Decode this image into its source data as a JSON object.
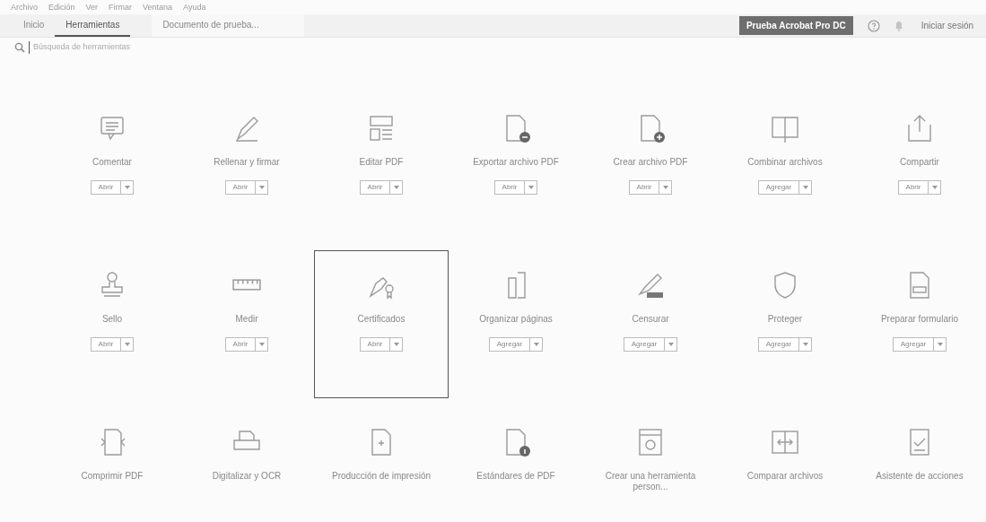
{
  "menu_bar": [
    "Archivo",
    "Edición",
    "Ver",
    "Firmar",
    "Ventana",
    "Ayuda"
  ],
  "tabs": [
    {
      "label": "Inicio",
      "selected": false
    },
    {
      "label": "Herramientas",
      "selected": true
    },
    {
      "label": "Documento de prueba...",
      "selected": false
    }
  ],
  "trial_button": "Prueba Acrobat Pro DC",
  "sign_in": "Iniciar sesión",
  "search": {
    "placeholder": "Búsqueda de herramientas"
  },
  "tools": [
    {
      "label": "Comentar",
      "button": "Abrir",
      "focused": false
    },
    {
      "label": "Rellenar y firmar",
      "button": "Abrir",
      "focused": false
    },
    {
      "label": "Editar PDF",
      "button": "Abrir",
      "focused": false
    },
    {
      "label": "Exportar archivo PDF",
      "button": "Abrir",
      "focused": false
    },
    {
      "label": "Crear archivo PDF",
      "button": "Abrir",
      "focused": false
    },
    {
      "label": "Combinar archivos",
      "button": "Agregar",
      "focused": false
    },
    {
      "label": "Compartir",
      "button": "Abrir",
      "focused": false
    },
    {
      "label": "Sello",
      "button": "Abrir",
      "focused": false
    },
    {
      "label": "Medir",
      "button": "Abrir",
      "focused": false
    },
    {
      "label": "Certificados",
      "button": "Abrir",
      "focused": true
    },
    {
      "label": "Organizar páginas",
      "button": "Agregar",
      "focused": false
    },
    {
      "label": "Censurar",
      "button": "Agregar",
      "focused": false
    },
    {
      "label": "Proteger",
      "button": "Agregar",
      "focused": false
    },
    {
      "label": "Preparar formulario",
      "button": "Agregar",
      "focused": false
    },
    {
      "label": "Comprimir PDF",
      "focused": false
    },
    {
      "label": "Digitalizar y OCR",
      "focused": false
    },
    {
      "label": "Producción de impresión",
      "focused": false
    },
    {
      "label": "Estándares de PDF",
      "focused": false
    },
    {
      "label": "Crear una herramienta person...",
      "focused": false
    },
    {
      "label": "Comparar archivos",
      "focused": false
    },
    {
      "label": "Asistente de acciones",
      "focused": false
    }
  ]
}
